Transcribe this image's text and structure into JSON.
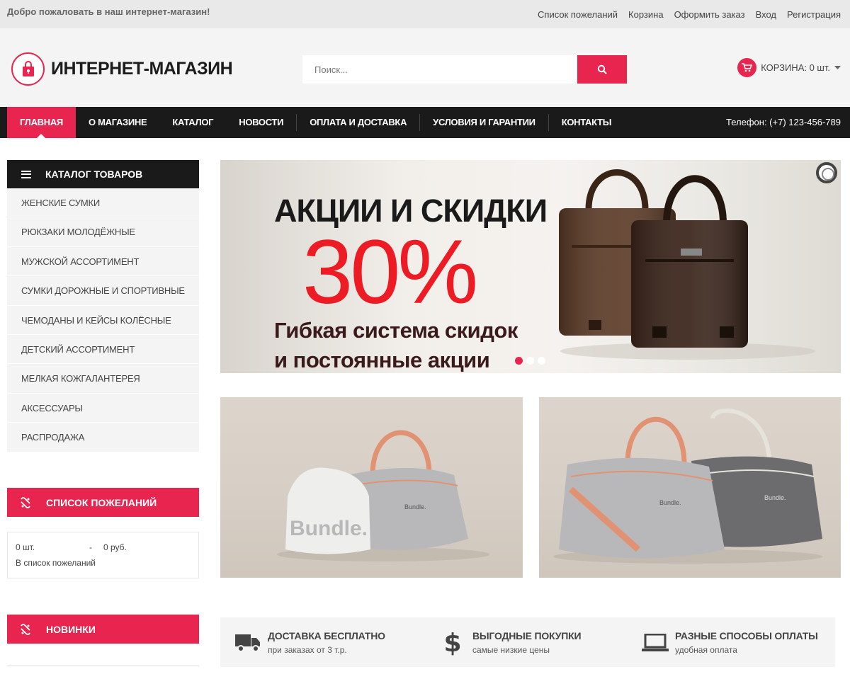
{
  "topbar": {
    "welcome": "Добро пожаловать в наш интернет-магазин!",
    "links": [
      "Список пожеланий",
      "Корзина",
      "Оформить заказ",
      "Вход",
      "Регистрация"
    ]
  },
  "header": {
    "logo_text": "ИНТЕРНЕТ-МАГАЗИН",
    "search_placeholder": "Поиск...",
    "cart_label": "КОРЗИНА: 0 шт."
  },
  "nav": {
    "items": [
      "ГЛАВНАЯ",
      "О МАГАЗИНЕ",
      "КАТАЛОГ",
      "НОВОСТИ",
      "ОПЛАТА И ДОСТАВКА",
      "УСЛОВИЯ И ГАРАНТИИ",
      "КОНТАКТЫ"
    ],
    "phone": "Телефон: (+7) 123-456-789"
  },
  "catalog": {
    "title": "КАТАЛОГ ТОВАРОВ",
    "items": [
      "ЖЕНСКИЕ СУМКИ",
      "РЮКЗАКИ МОЛОДЁЖНЫЕ",
      "МУЖСКОЙ АССОРТИМЕНТ",
      "СУМКИ ДОРОЖНЫЕ И СПОРТИВНЫЕ",
      "ЧЕМОДАНЫ И КЕЙСЫ КОЛЁСНЫЕ",
      "ДЕТСКИЙ АССОРТИМЕНТ",
      "МЕЛКАЯ КОЖГАЛАНТЕРЕЯ",
      "АКСЕССУАРЫ",
      "РАСПРОДАЖА"
    ]
  },
  "wishlist": {
    "title": "СПИСОК ПОЖЕЛАНИЙ",
    "qty": "0 шт.",
    "dash": "-",
    "sum": "0 руб.",
    "link": "В список пожеланий"
  },
  "news_block": {
    "title": "НОВИНКИ"
  },
  "slider": {
    "line1": "АКЦИИ И СКИДКИ",
    "line2": "30%",
    "line3": "Гибкая система скидок",
    "line4": "и постоянные акции",
    "dots": 3,
    "active_dot": 0
  },
  "banners": {
    "brand_text": "Bundle."
  },
  "features": [
    {
      "icon": "truck-icon",
      "title": "ДОСТАВКА БЕСПЛАТНО",
      "sub": "при заказах от 3 т.р."
    },
    {
      "icon": "dollar-icon",
      "title": "ВЫГОДНЫЕ ПОКУПКИ",
      "sub": "самые низкие цены"
    },
    {
      "icon": "laptop-icon",
      "title": "РАЗНЫЕ СПОСОБЫ ОПЛАТЫ",
      "sub": "удобная оплата"
    }
  ],
  "colors": {
    "accent": "#e8254f",
    "dark": "#1a1a1a",
    "light_bg": "#f4f4f4"
  }
}
